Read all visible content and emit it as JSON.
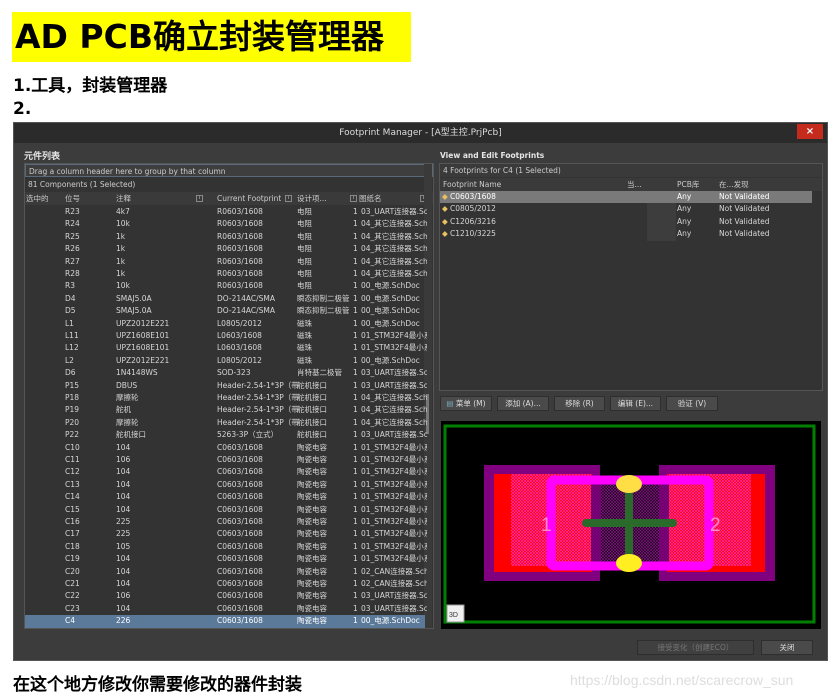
{
  "doc": {
    "title": "AD PCB确立封装管理器",
    "step1": "1.工具，封装管理器",
    "step2": "2.",
    "caption": "在这个地方修改你需要修改的器件封装",
    "watermark": "https://blog.csdn.net/scarecrow_sun"
  },
  "window": {
    "title": "Footprint Manager - [A型主控.PrjPcb]",
    "close": "×"
  },
  "left": {
    "section": "元件列表",
    "group_hint": "Drag a column header here to group by that column",
    "count": "81 Components (1 Selected)",
    "columns": [
      "选中的",
      "位号",
      "注释",
      "Current Footprint",
      "设计项...",
      "图纸名"
    ],
    "rows": [
      [
        "R23",
        "4k7",
        "R0603/1608",
        "电阻",
        "1",
        "03_UART连接器.Sch"
      ],
      [
        "R24",
        "10k",
        "R0603/1608",
        "电阻",
        "1",
        "04_其它连接器.Sch"
      ],
      [
        "R25",
        "1k",
        "R0603/1608",
        "电阻",
        "1",
        "04_其它连接器.Sch"
      ],
      [
        "R26",
        "1k",
        "R0603/1608",
        "电阻",
        "1",
        "04_其它连接器.Sch"
      ],
      [
        "R27",
        "1k",
        "R0603/1608",
        "电阻",
        "1",
        "04_其它连接器.Sch"
      ],
      [
        "R28",
        "1k",
        "R0603/1608",
        "电阻",
        "1",
        "04_其它连接器.Sch"
      ],
      [
        "R3",
        "10k",
        "R0603/1608",
        "电阻",
        "1",
        "00_电源.SchDoc"
      ],
      [
        "D4",
        "SMAJ5.0A",
        "DO-214AC/SMA",
        "瞬态抑制二极管",
        "1",
        "00_电源.SchDoc"
      ],
      [
        "D5",
        "SMAJ5.0A",
        "DO-214AC/SMA",
        "瞬态抑制二极管",
        "1",
        "00_电源.SchDoc"
      ],
      [
        "L1",
        "UPZ2012E221",
        "L0805/2012",
        "磁珠",
        "1",
        "00_电源.SchDoc"
      ],
      [
        "L11",
        "UPZ1608E101",
        "L0603/1608",
        "磁珠",
        "1",
        "01_STM32F4最小系"
      ],
      [
        "L12",
        "UPZ1608E101",
        "L0603/1608",
        "磁珠",
        "1",
        "01_STM32F4最小系"
      ],
      [
        "L2",
        "UPZ2012E221",
        "L0805/2012",
        "磁珠",
        "1",
        "00_电源.SchDoc"
      ],
      [
        "D6",
        "1N4148WS",
        "SOD-323",
        "肖特基二极管",
        "1",
        "03_UART连接器.Sch"
      ],
      [
        "P15",
        "DBUS",
        "Header-2.54-1*3P（带",
        "舵机接口",
        "1",
        "03_UART连接器.Sch"
      ],
      [
        "P18",
        "摩擦轮",
        "Header-2.54-1*3P（带",
        "舵机接口",
        "1",
        "04_其它连接器.Sch"
      ],
      [
        "P19",
        "舵机",
        "Header-2.54-1*3P（带",
        "舵机接口",
        "1",
        "04_其它连接器.Sch"
      ],
      [
        "P20",
        "摩擦轮",
        "Header-2.54-1*3P（带",
        "舵机接口",
        "1",
        "04_其它连接器.Sch"
      ],
      [
        "P22",
        "舵机接口",
        "5263-3P（立式）",
        "舵机接口",
        "1",
        "03_UART连接器.Sch"
      ],
      [
        "C10",
        "104",
        "C0603/1608",
        "陶瓷电容",
        "1",
        "01_STM32F4最小系"
      ],
      [
        "C11",
        "106",
        "C0603/1608",
        "陶瓷电容",
        "1",
        "01_STM32F4最小系"
      ],
      [
        "C12",
        "104",
        "C0603/1608",
        "陶瓷电容",
        "1",
        "01_STM32F4最小系"
      ],
      [
        "C13",
        "104",
        "C0603/1608",
        "陶瓷电容",
        "1",
        "01_STM32F4最小系"
      ],
      [
        "C14",
        "104",
        "C0603/1608",
        "陶瓷电容",
        "1",
        "01_STM32F4最小系"
      ],
      [
        "C15",
        "104",
        "C0603/1608",
        "陶瓷电容",
        "1",
        "01_STM32F4最小系"
      ],
      [
        "C16",
        "225",
        "C0603/1608",
        "陶瓷电容",
        "1",
        "01_STM32F4最小系"
      ],
      [
        "C17",
        "225",
        "C0603/1608",
        "陶瓷电容",
        "1",
        "01_STM32F4最小系"
      ],
      [
        "C18",
        "105",
        "C0603/1608",
        "陶瓷电容",
        "1",
        "01_STM32F4最小系"
      ],
      [
        "C19",
        "104",
        "C0603/1608",
        "陶瓷电容",
        "1",
        "01_STM32F4最小系"
      ],
      [
        "C20",
        "104",
        "C0603/1608",
        "陶瓷电容",
        "1",
        "02_CAN连接器.Sch"
      ],
      [
        "C21",
        "104",
        "C0603/1608",
        "陶瓷电容",
        "1",
        "02_CAN连接器.Sch"
      ],
      [
        "C22",
        "106",
        "C0603/1608",
        "陶瓷电容",
        "1",
        "03_UART连接器.Sch"
      ],
      [
        "C23",
        "104",
        "C0603/1608",
        "陶瓷电容",
        "1",
        "03_UART连接器.Sch"
      ],
      [
        "C4",
        "226",
        "C0603/1608",
        "陶瓷电容",
        "1",
        "00_电源.SchDoc"
      ]
    ],
    "selected_index": 33
  },
  "right": {
    "section": "View and Edit Footprints",
    "count": "4 Footprints for C4 (1 Selected)",
    "columns": [
      "Footprint Name",
      "当...",
      "PCB库",
      "在...发现"
    ],
    "rows": [
      [
        "C0603/1608",
        "Any",
        "Not Validated"
      ],
      [
        "C0805/2012",
        "Any",
        "Not Validated"
      ],
      [
        "C1206/3216",
        "Any",
        "Not Validated"
      ],
      [
        "C1210/3225",
        "Any",
        "Not Validated"
      ]
    ],
    "selected_index": 0,
    "buttons": {
      "menu": "菜单 (M)",
      "add": "添加 (A)...",
      "remove": "移除 (R)",
      "edit": "编辑 (E)...",
      "validate": "验证 (V)"
    },
    "preview": {
      "pad1": "1",
      "pad2": "2",
      "btn3d": "3D"
    }
  },
  "footer": {
    "accept": "接受变化（创建ECO）",
    "close": "关闭"
  },
  "colors": {
    "highlight": "#ffff00",
    "selection": "#5b7a99",
    "close": "#c42b1c",
    "pad": "#ff0000",
    "overlay": "#ff00ff",
    "keepout": "#008000"
  }
}
